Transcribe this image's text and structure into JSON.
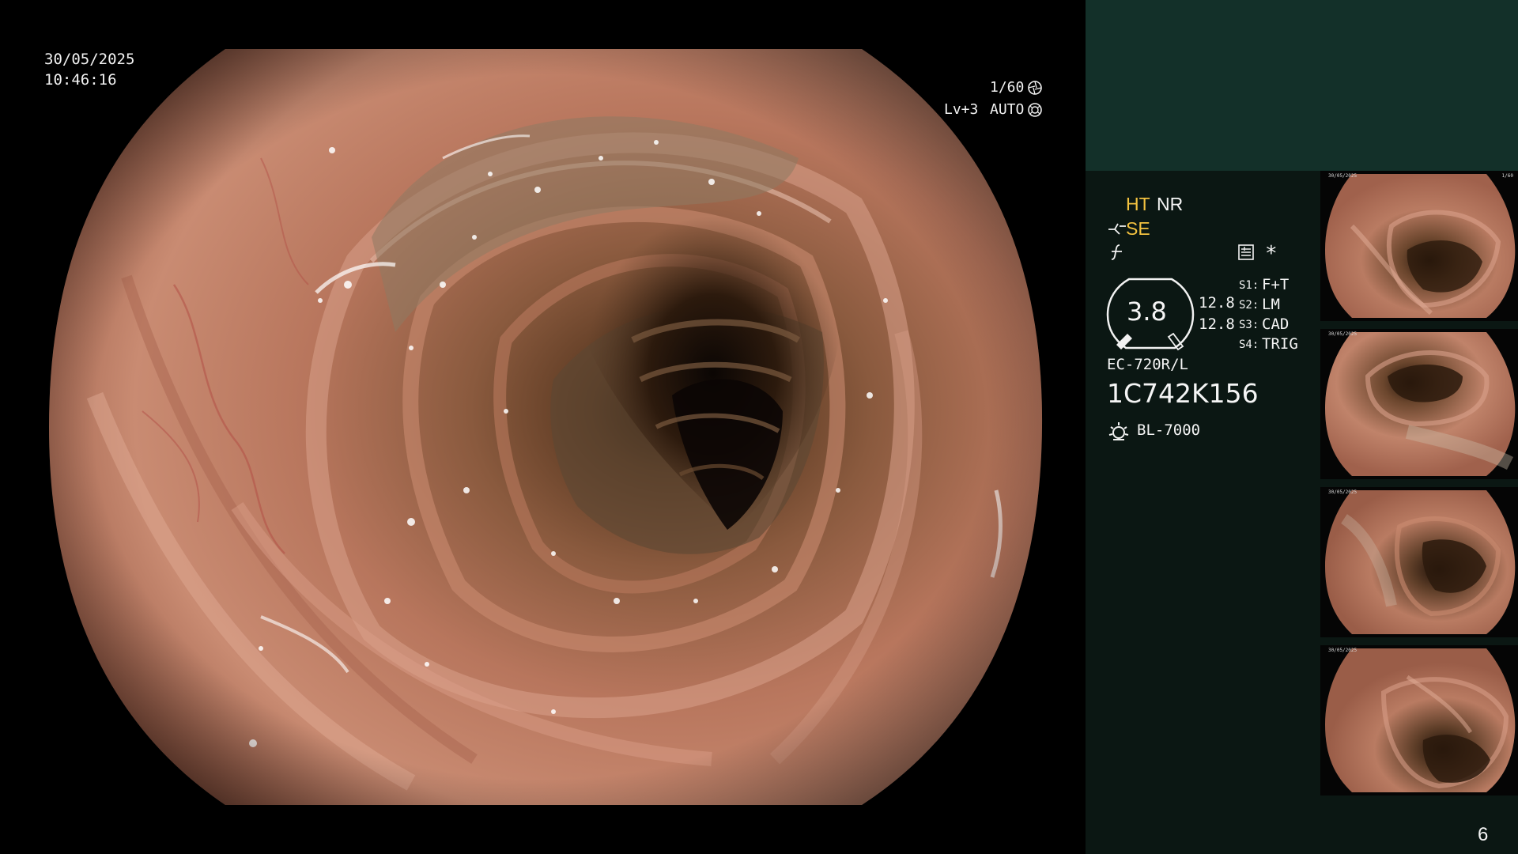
{
  "overlay": {
    "date": "30/05/2025",
    "time": "10:46:16",
    "shutter": "1/60",
    "level": "Lv+3",
    "exposure_mode": "AUTO"
  },
  "panel": {
    "mode_ht": "HT",
    "mode_nr": "NR",
    "mode_se": "SE",
    "asterisk": "*",
    "gauge_value": "3.8",
    "gauge_side_1": "12.8",
    "gauge_side_2": "12.8",
    "settings": [
      {
        "key": "S1:",
        "value": "F+T"
      },
      {
        "key": "S2:",
        "value": "LM"
      },
      {
        "key": "S3:",
        "value": "CAD"
      },
      {
        "key": "S4:",
        "value": "TRIG"
      }
    ],
    "scope_model": "EC-720R/L",
    "serial": "1C742K156",
    "light_source": "BL-7000",
    "page_number": "6"
  },
  "icons": {
    "shutter_icon": "aperture-icon",
    "auto_icon": "iris-icon",
    "scope_icon": "scope-angle-icon",
    "freeze_icon": "freeze-icon",
    "memo_icon": "memo-icon",
    "light_icon": "light-source-icon"
  },
  "colors": {
    "header_bg": "#133029",
    "panel_bg": "#0b1713",
    "accent_yellow": "#f3c240"
  }
}
